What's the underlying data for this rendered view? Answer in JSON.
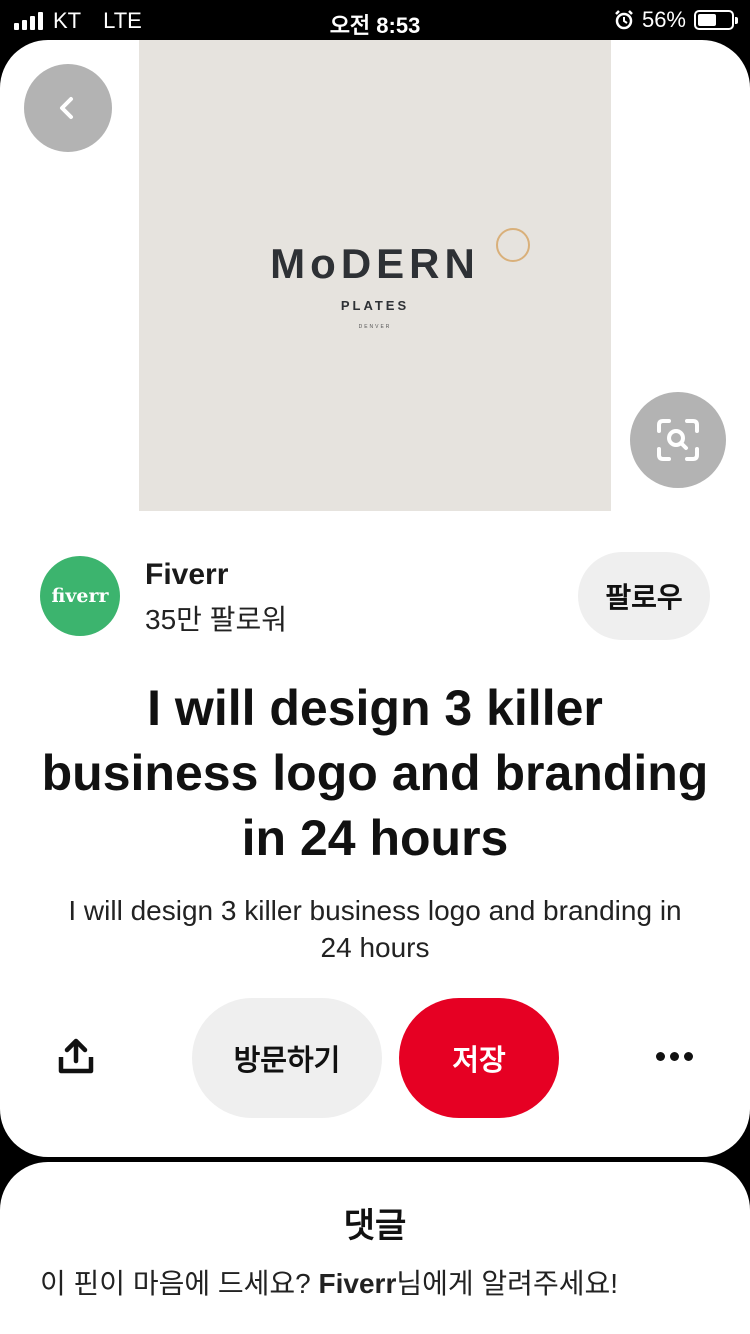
{
  "status_bar": {
    "carrier": "KT",
    "network": "LTE",
    "time": "오전 8:53",
    "battery": "56%",
    "battery_level": 0.56
  },
  "pin": {
    "image": {
      "logo_word": "MoDERN",
      "logo_sub": "PLATES",
      "logo_city": "DENVER",
      "background_color": "#e6e3de"
    },
    "title": "I will design 3 killer business logo and branding in 24 hours",
    "description": "I will design 3 killer business logo and branding in 24 hours"
  },
  "creator": {
    "avatar_text": "fiverr",
    "name": "Fiverr",
    "followers": "35만 팔로워",
    "follow_label": "팔로우",
    "avatar_color": "#3cb46e"
  },
  "actions": {
    "visit_label": "방문하기",
    "save_label": "저장",
    "save_color": "#e60023"
  },
  "comments": {
    "title": "댓글",
    "prompt_prefix": "이 핀이 마음에 드세요? ",
    "prompt_name": "Fiverr",
    "prompt_suffix": "님에게 알려주세요!"
  },
  "icons": {
    "back": "chevron-left-icon",
    "lens": "visual-search-icon",
    "share": "share-upload-icon",
    "more": "more-dots-icon"
  }
}
